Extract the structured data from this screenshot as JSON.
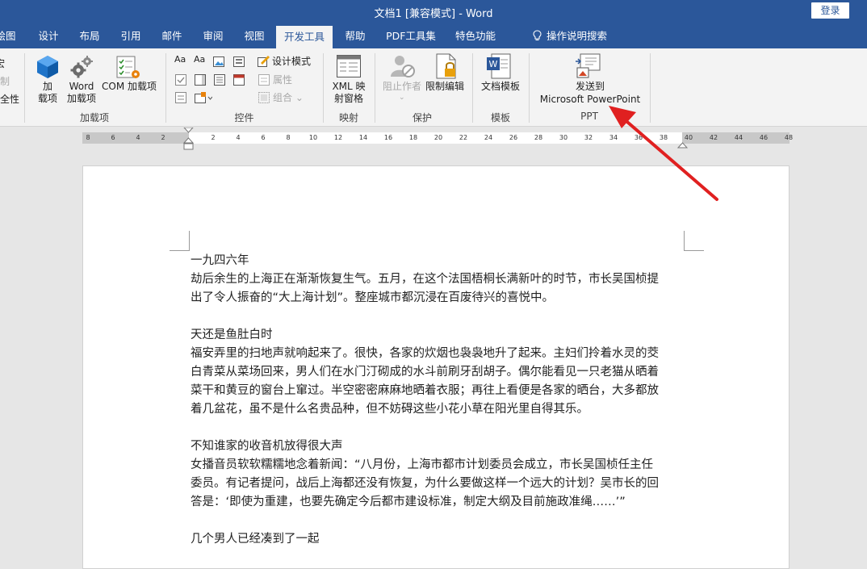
{
  "title_bar": {
    "title": "文档1 [兼容模式] - Word",
    "login": "登录"
  },
  "tabs": [
    "绘图",
    "设计",
    "布局",
    "引用",
    "邮件",
    "审阅",
    "视图",
    "开发工具",
    "帮助",
    "PDF工具集",
    "特色功能",
    "操作说明搜索"
  ],
  "active_tab": "开发工具",
  "ribbon": {
    "left_partial": [
      "宏",
      "录制",
      "宏安全性"
    ],
    "addins": {
      "addin_label": "加\n载项",
      "word_addin_label": "Word\n加载项",
      "com_addin_label": "COM 加载项",
      "group": "加载项"
    },
    "controls": {
      "design_mode": "设计模式",
      "properties": "属性",
      "group_btn": "组合",
      "group": "控件"
    },
    "mapping": {
      "xml_label": "XML 映\n射窗格",
      "group": "映射"
    },
    "protect": {
      "block_authors": "阻止作者",
      "restrict_editing": "限制编辑",
      "group": "保护"
    },
    "templates": {
      "doc_template": "文档模板",
      "group": "模板"
    },
    "ppt": {
      "send_label_1": "发送到",
      "send_label_2": "Microsoft PowerPoint",
      "group": "PPT"
    }
  },
  "ruler": {
    "ticks": [
      "8",
      "6",
      "4",
      "2",
      "2",
      "4",
      "6",
      "8",
      "10",
      "12",
      "14",
      "16",
      "18",
      "20",
      "22",
      "24",
      "26",
      "28",
      "30",
      "32",
      "34",
      "36",
      "38",
      "40",
      "42",
      "44",
      "46",
      "48"
    ]
  },
  "document": {
    "paragraphs": [
      "一九四六年",
      "劫后余生的上海正在渐渐恢复生气。五月，在这个法国梧桐长满新叶的时节，市长吴国桢提",
      "出了令人振奋的“大上海计划”。整座城市都沉浸在百废待兴的喜悦中。",
      "",
      "天还是鱼肚白时",
      "福安弄里的扫地声就响起来了。很快，各家的炊烟也袅袅地升了起来。主妇们拎着水灵的茭",
      "白青菜从菜场回来，男人们在水门汀砌成的水斗前刷牙刮胡子。偶尔能看见一只老猫从晒着",
      "菜干和黄豆的窗台上窜过。半空密密麻麻地晒着衣服；再往上看便是各家的晒台，大多都放",
      "着几盆花，虽不是什么名贵品种，但不妨碍这些小花小草在阳光里自得其乐。",
      "",
      "不知谁家的收音机放得很大声",
      "女播音员软软糯糯地念着新闻：“八月份，上海市都市计划委员会成立，市长吴国桢任主任",
      "委员。有记者提问，战后上海都还没有恢复，为什么要做这样一个远大的计划？吴市长的回",
      "答是：‘即使为重建，也要先确定今后都市建设标准，制定大纲及目前施政准绳……’”",
      "",
      "几个男人已经凑到了一起"
    ]
  },
  "colors": {
    "brand": "#2b579a",
    "arrow": "#e02020",
    "ribbon_bg": "#f3f3f3"
  }
}
